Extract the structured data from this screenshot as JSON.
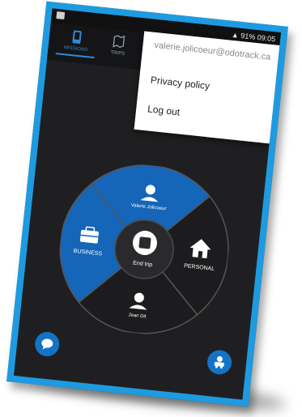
{
  "status_bar": {
    "right_text": "91% 09:05"
  },
  "tabs": [
    {
      "label": "MISSIONS",
      "active": true
    },
    {
      "label": "TRIPS",
      "active": false
    }
  ],
  "overflow_menu": {
    "account_email": "valerie.jolicoeur@odotrack.ca",
    "items": [
      {
        "label": "Privacy policy"
      },
      {
        "label": "Log out"
      }
    ]
  },
  "trip_wheel": {
    "top_segment_label": "Valerie Jolicoeur",
    "left_segment_label": "BUSINESS",
    "right_segment_label": "PERSONAL",
    "bottom_segment_label": "Jean Dit",
    "center_label": "End trip",
    "colors": {
      "selected": "#1565b8",
      "unselected": "#1c1c1e",
      "divider": "#555555"
    }
  },
  "bottom_buttons": {
    "chat_icon": "speech-bubble-icon",
    "vehicle_icon": "car-location-icon"
  },
  "colors": {
    "frame": "#1e9be0",
    "app_bg": "#1f1f21",
    "accent": "#2f8ad8"
  }
}
